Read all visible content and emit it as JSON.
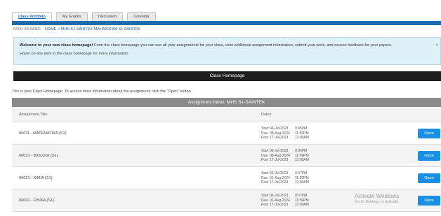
{
  "tabs": [
    {
      "label": "Class Portfolio",
      "active": true
    },
    {
      "label": "My Grades",
      "active": false
    },
    {
      "label": "Discussion",
      "active": false
    },
    {
      "label": "Calendar",
      "active": false
    }
  ],
  "breadcrumb": {
    "label": "NOW VIEWING:",
    "path": "HOME > MHS S1 SAINTEK MAHASISWA S1 SAINTEK"
  },
  "welcome": {
    "bold": "Welcome to your new class homepage!",
    "text": " From the class homepage you can see all your assignments for your class, view additional assignment information, submit your work, and access feedback for your papers.",
    "hint": "Hover on any item in the class homepage for more information",
    "close": "×"
  },
  "class_homepage_title": "Class Homepage",
  "intro": "This is your Class Homepage. To access more information about the assignment, click the \"Open\" button.",
  "inbox": {
    "title": "Assignment Inbox: MHS S1-SAINTEK",
    "col_title": "Assignment Title",
    "col_dates": "Dates",
    "rows": [
      {
        "title": "06011 - MATEMATIKA (S1)",
        "start": {
          "label": "Start",
          "date": "09-Jul-2023",
          "time": "9:05PM"
        },
        "due": {
          "label": "Due",
          "date": "08-Aug-2024",
          "time": "11:59PM"
        },
        "post": {
          "label": "Post",
          "date": "17-Jul-2023",
          "time": "12:00AM"
        },
        "button": "Open"
      },
      {
        "title": "06021 - BIOLOGI (S1)",
        "start": {
          "label": "Start",
          "date": "09-Jul-2023",
          "time": "9:06PM"
        },
        "due": {
          "label": "Due",
          "date": "08-Aug-2024",
          "time": "11:59PM"
        },
        "post": {
          "label": "Post",
          "date": "17-Jul-2023",
          "time": "12:00AM"
        },
        "button": "Open"
      },
      {
        "title": "06031 - KIMIA (S1)",
        "start": {
          "label": "Start",
          "date": "09-Jul-2023",
          "time": "9:07PM"
        },
        "due": {
          "label": "Due",
          "date": "01-Aug-2024",
          "time": "11:59PM"
        },
        "post": {
          "label": "Post",
          "date": "17-Jul-2023",
          "time": "12:00AM"
        },
        "button": "Open"
      },
      {
        "title": "06041 - FISIKA (S1)",
        "start": {
          "label": "Start",
          "date": "09-Jul-2023",
          "time": "9:07PM"
        },
        "due": {
          "label": "Due",
          "date": "01-Aug-2024",
          "time": "11:59PM"
        },
        "post": {
          "label": "Post",
          "date": "17-Jul-2023",
          "time": "12:00AM"
        },
        "button": "Open"
      }
    ]
  },
  "watermark": {
    "line1": "Activate Windows",
    "line2": "Go to Settings to activate"
  },
  "colors": {
    "accent": "#1f6aa8",
    "open_button": "#1a8fe3",
    "welcome_bg": "#dff1f8"
  }
}
